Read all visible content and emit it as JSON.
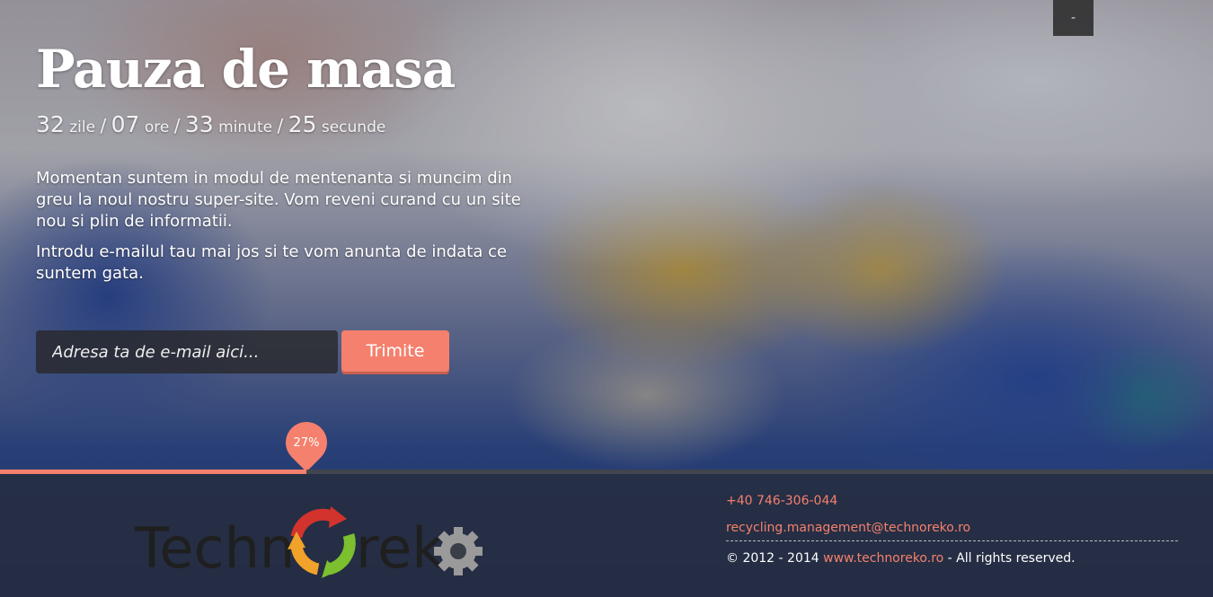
{
  "header": {
    "corner_button_label": "-"
  },
  "main": {
    "title": "Pauza de masa",
    "countdown": {
      "days": "32",
      "days_label": "zile",
      "hours": "07",
      "hours_label": "ore",
      "minutes": "33",
      "minutes_label": "minute",
      "seconds": "25",
      "seconds_label": "secunde",
      "separator": "/"
    },
    "message_1": "Momentan suntem in modul de mentenanta si muncim din greu la noul nostru super-site. Vom reveni curand cu un site nou si plin de informatii.",
    "message_2": "Introdu e-mailul tau mai jos si te vom anunta de indata ce suntem gata.",
    "form": {
      "email_placeholder": "Adresa ta de e-mail aici...",
      "email_value": "",
      "submit_label": "Trimite"
    }
  },
  "progress": {
    "value": 0.27,
    "label": "27%"
  },
  "footer": {
    "logo": {
      "text_left": "Techn",
      "text_right": "rek",
      "icon": "recycle-arrows-icon",
      "gear_icon": "gear-icon"
    },
    "phone": "+40 746-306-044",
    "email": "recycling.management@technoreko.ro",
    "copyright_prefix": "© 2012 - 2014",
    "website": "www.technoreko.ro",
    "copyright_suffix": "- All rights reserved."
  },
  "colors": {
    "accent": "#f4806d",
    "footer_bg": "#262a34",
    "progress_track": "#464646"
  }
}
